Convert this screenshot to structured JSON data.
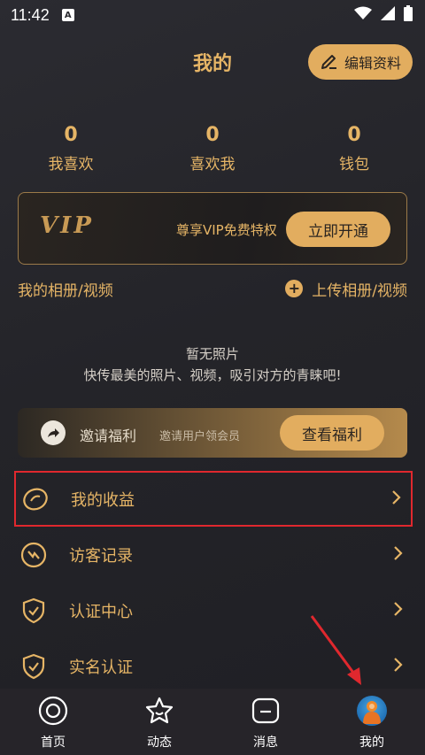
{
  "status_bar": {
    "time": "11:42",
    "notification_letter": "A"
  },
  "header": {
    "title": "我的",
    "edit_label": "编辑资料"
  },
  "stats": [
    {
      "value": "0",
      "label": "我喜欢"
    },
    {
      "value": "0",
      "label": "喜欢我"
    },
    {
      "value": "0",
      "label": "钱包"
    }
  ],
  "vip": {
    "logo": "VIP",
    "text": "尊享VIP免费特权",
    "button": "立即开通"
  },
  "album": {
    "title": "我的相册/视频",
    "upload_label": "上传相册/视频",
    "plus": "+"
  },
  "empty_state": {
    "line1": "暂无照片",
    "line2": "快传最美的照片、视频，吸引对方的青睐吧!"
  },
  "invite": {
    "title": "邀请福利",
    "subtitle": "邀请用户领会员",
    "button": "查看福利"
  },
  "menu": [
    {
      "label": "我的收益",
      "icon": "earnings-icon"
    },
    {
      "label": "访客记录",
      "icon": "visitor-icon"
    },
    {
      "label": "认证中心",
      "icon": "verify-shield-icon"
    },
    {
      "label": "实名认证",
      "icon": "id-shield-icon"
    }
  ],
  "tabs": [
    {
      "label": "首页",
      "icon": "home-icon"
    },
    {
      "label": "动态",
      "icon": "star-icon"
    },
    {
      "label": "消息",
      "icon": "message-icon"
    },
    {
      "label": "我的",
      "icon": "avatar"
    }
  ],
  "colors": {
    "accent": "#e6b566",
    "button": "#e2ad5f",
    "background": "#242429",
    "highlight": "#e0282e"
  }
}
